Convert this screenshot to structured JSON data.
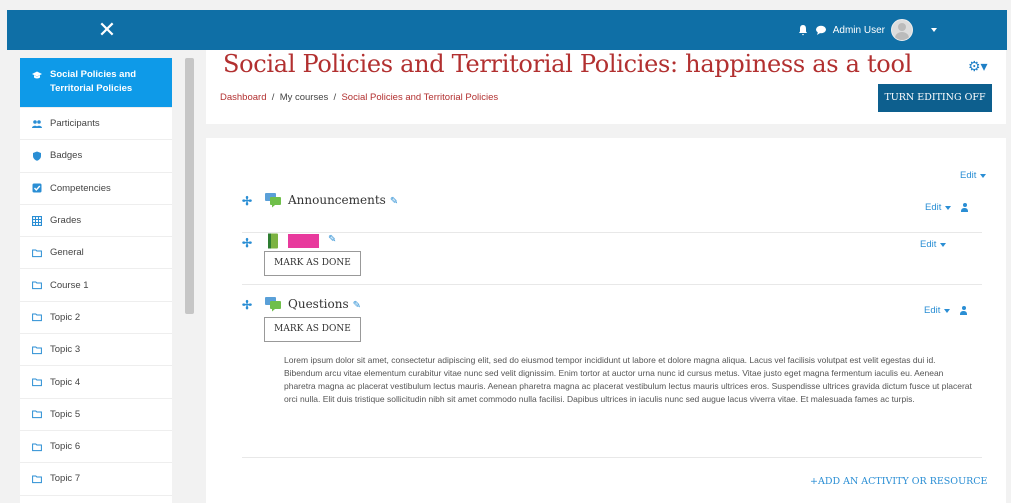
{
  "topbar": {
    "user_name": "Admin User"
  },
  "sidebar": {
    "items": [
      {
        "label": "Social Policies and Territorial Policies",
        "icon": "graduation-cap-icon",
        "active": true
      },
      {
        "label": "Participants",
        "icon": "users-icon"
      },
      {
        "label": "Badges",
        "icon": "shield-icon"
      },
      {
        "label": "Competencies",
        "icon": "checkbox-icon"
      },
      {
        "label": "Grades",
        "icon": "table-icon"
      },
      {
        "label": "General",
        "icon": "folder-icon"
      },
      {
        "label": "Course 1",
        "icon": "folder-icon"
      },
      {
        "label": "Topic 2",
        "icon": "folder-icon"
      },
      {
        "label": "Topic 3",
        "icon": "folder-icon"
      },
      {
        "label": "Topic 4",
        "icon": "folder-icon"
      },
      {
        "label": "Topic 5",
        "icon": "folder-icon"
      },
      {
        "label": "Topic 6",
        "icon": "folder-icon"
      },
      {
        "label": "Topic 7",
        "icon": "folder-icon"
      }
    ]
  },
  "header": {
    "title": "Social Policies and Territorial Policies: happiness as a tool",
    "breadcrumb": {
      "dashboard": "Dashboard",
      "sep": "/",
      "my_courses": "My courses",
      "course": "Social Policies and Territorial Policies"
    },
    "turn_editing_off": "TURN EDITING OFF"
  },
  "section": {
    "edit_label": "Edit",
    "activities": [
      {
        "name": "Announcements",
        "type": "forum"
      },
      {
        "name": "Book",
        "type": "book",
        "mark_done": "MARK AS DONE"
      },
      {
        "name": "Questions",
        "type": "forum",
        "mark_done": "MARK AS DONE"
      }
    ],
    "description": "Lorem ipsum dolor sit amet, consectetur adipiscing elit, sed do eiusmod tempor incididunt ut labore et dolore magna aliqua. Lacus vel facilisis volutpat est velit egestas dui id. Bibendum arcu vitae elementum curabitur vitae nunc sed velit dignissim. Enim tortor at auctor urna nunc id cursus metus. Vitae justo eget magna fermentum iaculis eu. Aenean pharetra magna ac placerat vestibulum lectus mauris. Aenean pharetra magna ac placerat vestibulum lectus mauris ultrices eros. Suspendisse ultrices gravida dictum fusce ut placerat orci nulla. Elit duis tristique sollicitudin nibh sit amet commodo nulla facilisi. Dapibus ultrices in iaculis nunc sed augue lacus viverra vitae. Et malesuada fames ac turpis.",
    "add_activity": "ADD AN ACTIVITY OR RESOURCE"
  },
  "colors": {
    "topbar": "#0f6fa6",
    "active_item": "#0e9ae8",
    "title": "#b23030",
    "link": "#2a8ed4",
    "button": "#0d5f8e"
  }
}
